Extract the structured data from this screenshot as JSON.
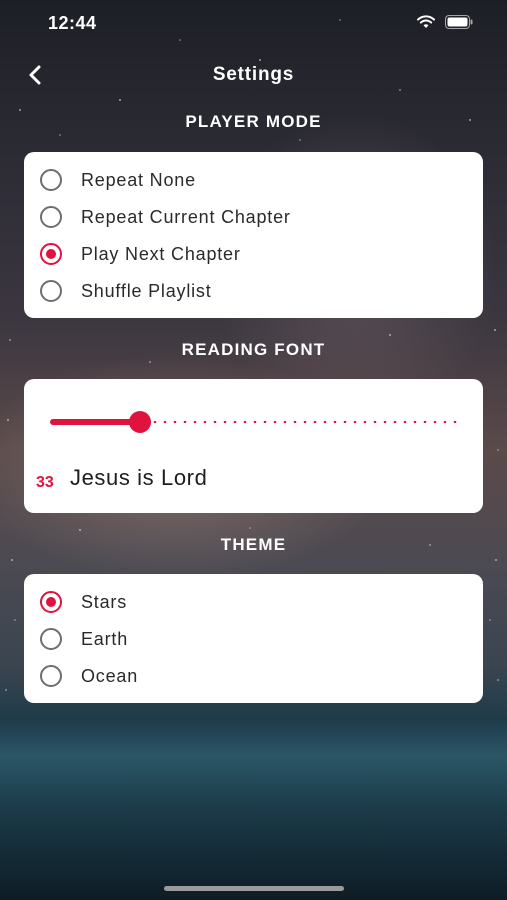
{
  "status_bar": {
    "time": "12:44",
    "icons": [
      "wifi-icon",
      "battery-icon"
    ]
  },
  "nav": {
    "title": "Settings",
    "back_icon": "chevron-left-icon"
  },
  "player_mode": {
    "header": "PLAYER MODE",
    "options": [
      {
        "label": "Repeat None",
        "selected": false
      },
      {
        "label": "Repeat Current Chapter",
        "selected": false
      },
      {
        "label": "Play Next Chapter",
        "selected": true
      },
      {
        "label": "Shuffle Playlist",
        "selected": false
      }
    ]
  },
  "reading_font": {
    "header": "READING FONT",
    "size_value": "33",
    "preview_text": "Jesus is Lord",
    "slider_fraction": 0.17
  },
  "theme": {
    "header": "THEME",
    "options": [
      {
        "label": "Stars",
        "selected": true
      },
      {
        "label": "Earth",
        "selected": false
      },
      {
        "label": "Ocean",
        "selected": false
      }
    ]
  },
  "colors": {
    "accent": "#e0123e",
    "card": "#ffffff",
    "text": "#2a2a2a"
  }
}
